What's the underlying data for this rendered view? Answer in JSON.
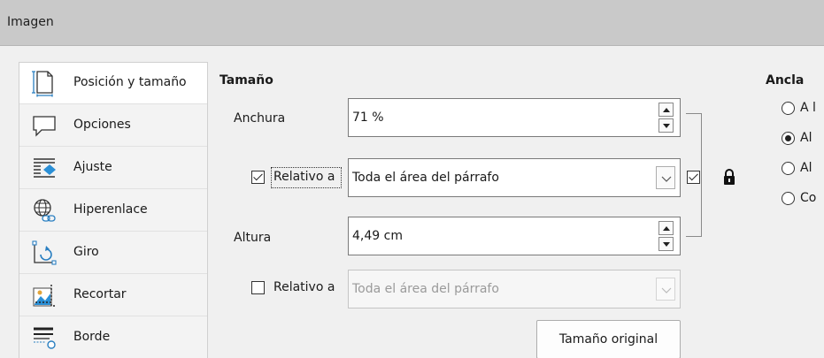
{
  "window": {
    "title": "Imagen"
  },
  "sidebar": {
    "items": [
      {
        "label": "Posición y tamaño",
        "icon": "position-size-icon",
        "selected": true
      },
      {
        "label": "Opciones",
        "icon": "speech-bubble-icon",
        "selected": false
      },
      {
        "label": "Ajuste",
        "icon": "wrap-icon",
        "selected": false
      },
      {
        "label": "Hiperenlace",
        "icon": "globe-link-icon",
        "selected": false
      },
      {
        "label": "Giro",
        "icon": "rotate-icon",
        "selected": false
      },
      {
        "label": "Recortar",
        "icon": "crop-icon",
        "selected": false
      },
      {
        "label": "Borde",
        "icon": "border-icon",
        "selected": false
      }
    ]
  },
  "size": {
    "title": "Tamaño",
    "width_label": "Anchura",
    "width_value": "71 %",
    "width_relative_label": "Relativo a",
    "width_relative_checked": true,
    "width_relative_value": "Toda el área del párrafo",
    "height_label": "Altura",
    "height_value": "4,49 cm",
    "height_relative_label": "Relativo a",
    "height_relative_checked": false,
    "height_relative_value": "Toda el área del párrafo",
    "keep_ratio_checked": true,
    "original_size_button": "Tamaño original"
  },
  "anchor": {
    "title": "Ancla",
    "options": [
      {
        "label": "A l",
        "checked": false
      },
      {
        "label": "Al",
        "checked": true
      },
      {
        "label": "Al",
        "checked": false
      },
      {
        "label": "Co",
        "checked": false
      }
    ]
  },
  "colors": {
    "titlebar": "#c9c9c9",
    "selected_item": "#ffffff",
    "accent": "#1a1a1a"
  }
}
